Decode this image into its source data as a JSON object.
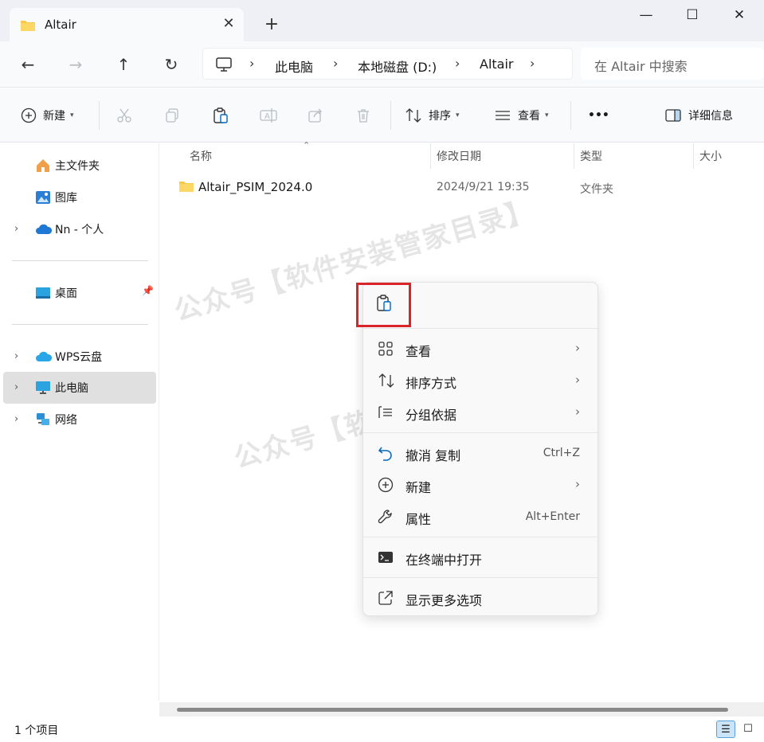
{
  "window": {
    "tab_title": "Altair",
    "new_tab": "+",
    "close_tab": "✕",
    "minimize": "—",
    "maximize": "☐",
    "close": "✕"
  },
  "nav": {
    "breadcrumbs": [
      "此电脑",
      "本地磁盘 (D:)",
      "Altair"
    ],
    "search_placeholder": "在 Altair 中搜索"
  },
  "commands": {
    "new": "新建",
    "sort": "排序",
    "view": "查看",
    "more": "•••",
    "details": "详细信息"
  },
  "sidebar": {
    "items": [
      {
        "label": "主文件夹"
      },
      {
        "label": "图库"
      },
      {
        "label": "Nn - 个人"
      },
      {
        "label": "桌面"
      },
      {
        "label": "WPS云盘"
      },
      {
        "label": "此电脑"
      },
      {
        "label": "网络"
      }
    ]
  },
  "columns": {
    "name": "名称",
    "date": "修改日期",
    "type": "类型",
    "size": "大小"
  },
  "files": [
    {
      "name": "Altair_PSIM_2024.0",
      "date": "2024/9/21 19:35",
      "type": "文件夹"
    }
  ],
  "status": {
    "count": "1 个项目"
  },
  "context_menu": {
    "items": [
      {
        "label": "查看"
      },
      {
        "label": "排序方式"
      },
      {
        "label": "分组依据"
      },
      {
        "label": "撤消 复制",
        "shortcut": "Ctrl+Z"
      },
      {
        "label": "新建"
      },
      {
        "label": "属性",
        "shortcut": "Alt+Enter"
      },
      {
        "label": "在终端中打开"
      },
      {
        "label": "显示更多选项"
      }
    ]
  },
  "watermark": "公众号【软件安装管家目录】",
  "colors": {
    "accent": "#0067c0",
    "selection": "#e0e0e0",
    "highlight_box": "#d9252a",
    "folder": "#f8c84a"
  }
}
